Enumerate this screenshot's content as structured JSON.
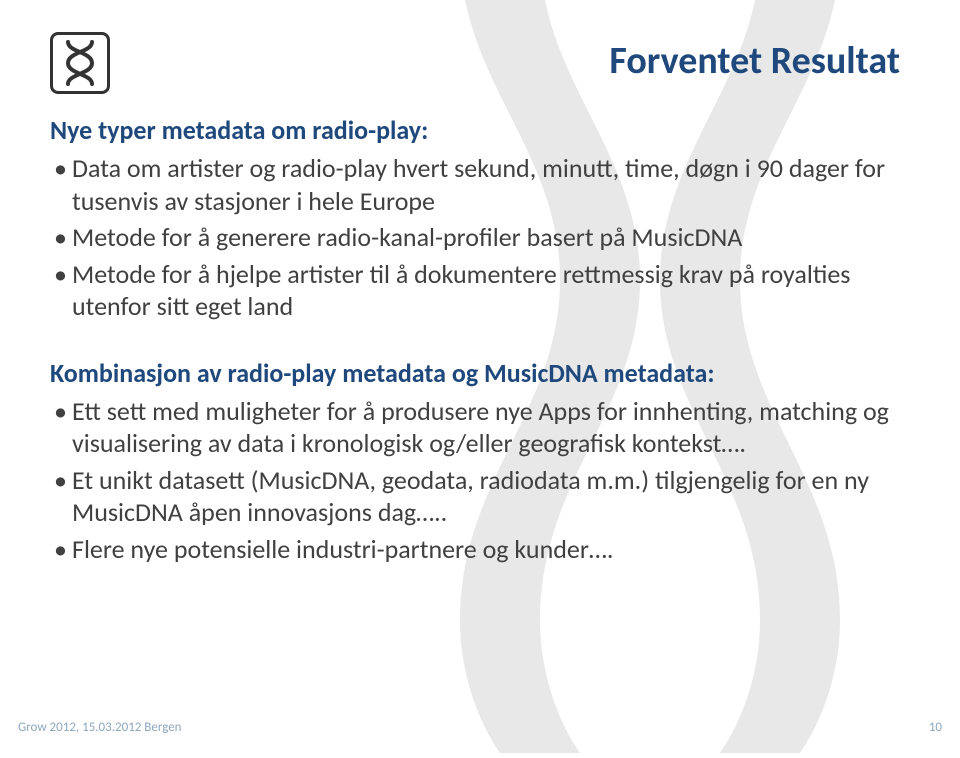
{
  "title": "Forventet Resultat",
  "section1": {
    "heading": "Nye typer  metadata om radio-play:",
    "items": [
      "Data om artister og radio-play hvert sekund, minutt, time, døgn i 90 dager for tusenvis av stasjoner i hele Europe",
      "Metode for å generere radio-kanal-profiler basert på MusicDNA",
      "Metode for å hjelpe artister til å dokumentere rettmessig krav på royalties utenfor sitt eget land"
    ]
  },
  "section2": {
    "heading": "Kombinasjon av radio-play metadata og MusicDNA metadata:",
    "items": [
      "Ett sett med muligheter for å produsere nye Apps for innhenting, matching og visualisering av data i kronologisk og/eller geografisk kontekst….",
      "Et unikt datasett (MusicDNA, geodata, radiodata m.m.) tilgjengelig for en ny MusicDNA åpen innovasjons dag…..",
      "Flere nye potensielle industri-partnere og kunder…."
    ]
  },
  "footer": {
    "left": "Grow 2012, 15.03.2012 Bergen",
    "right": "10"
  }
}
